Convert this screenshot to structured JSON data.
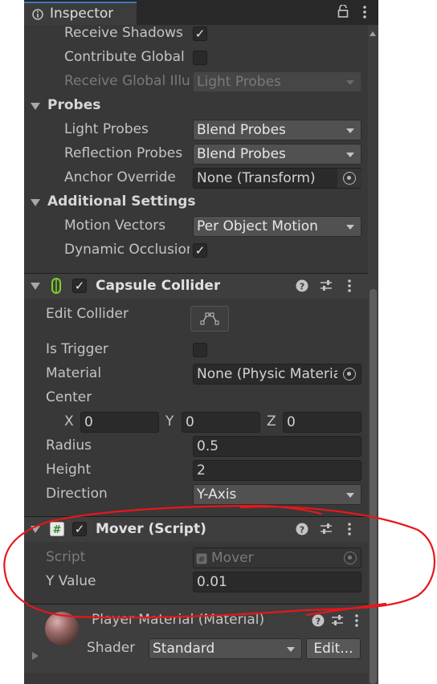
{
  "tab": {
    "title": "Inspector",
    "lock_icon": "lock-icon",
    "menu_icon": "kebab-menu-icon"
  },
  "mesh_renderer": {
    "receive_shadows": {
      "label": "Receive Shadows",
      "checked": true
    },
    "contribute_global": {
      "label": "Contribute Global",
      "checked": false
    },
    "receive_global": {
      "label": "Receive Global Illumination",
      "value": "Light Probes"
    }
  },
  "probes": {
    "title": "Probes",
    "light_probes": {
      "label": "Light Probes",
      "value": "Blend Probes"
    },
    "reflection_probes": {
      "label": "Reflection Probes",
      "value": "Blend Probes"
    },
    "anchor_override": {
      "label": "Anchor Override",
      "value": "None (Transform)"
    }
  },
  "additional": {
    "title": "Additional Settings",
    "motion_vectors": {
      "label": "Motion Vectors",
      "value": "Per Object Motion"
    },
    "dynamic_occlusion": {
      "label": "Dynamic Occlusion",
      "checked": true
    }
  },
  "capsule_collider": {
    "title": "Capsule Collider",
    "enabled": true,
    "edit_collider": "Edit Collider",
    "is_trigger": {
      "label": "Is Trigger",
      "checked": false
    },
    "material": {
      "label": "Material",
      "value": "None (Physic Material)"
    },
    "center": {
      "label": "Center",
      "x_label": "X",
      "x": "0",
      "y_label": "Y",
      "y": "0",
      "z_label": "Z",
      "z": "0"
    },
    "radius": {
      "label": "Radius",
      "value": "0.5"
    },
    "height": {
      "label": "Height",
      "value": "2"
    },
    "direction": {
      "label": "Direction",
      "value": "Y-Axis"
    }
  },
  "mover": {
    "title": "Mover (Script)",
    "enabled": true,
    "script": {
      "label": "Script",
      "value": "Mover"
    },
    "y_value": {
      "label": "Y Value",
      "value": "0.01"
    }
  },
  "material": {
    "title": "Player Material (Material)",
    "shader_label": "Shader",
    "shader_value": "Standard",
    "edit_button": "Edit..."
  },
  "colors": {
    "annotation_red": "#e8161b",
    "accent": "#3a79bb"
  }
}
